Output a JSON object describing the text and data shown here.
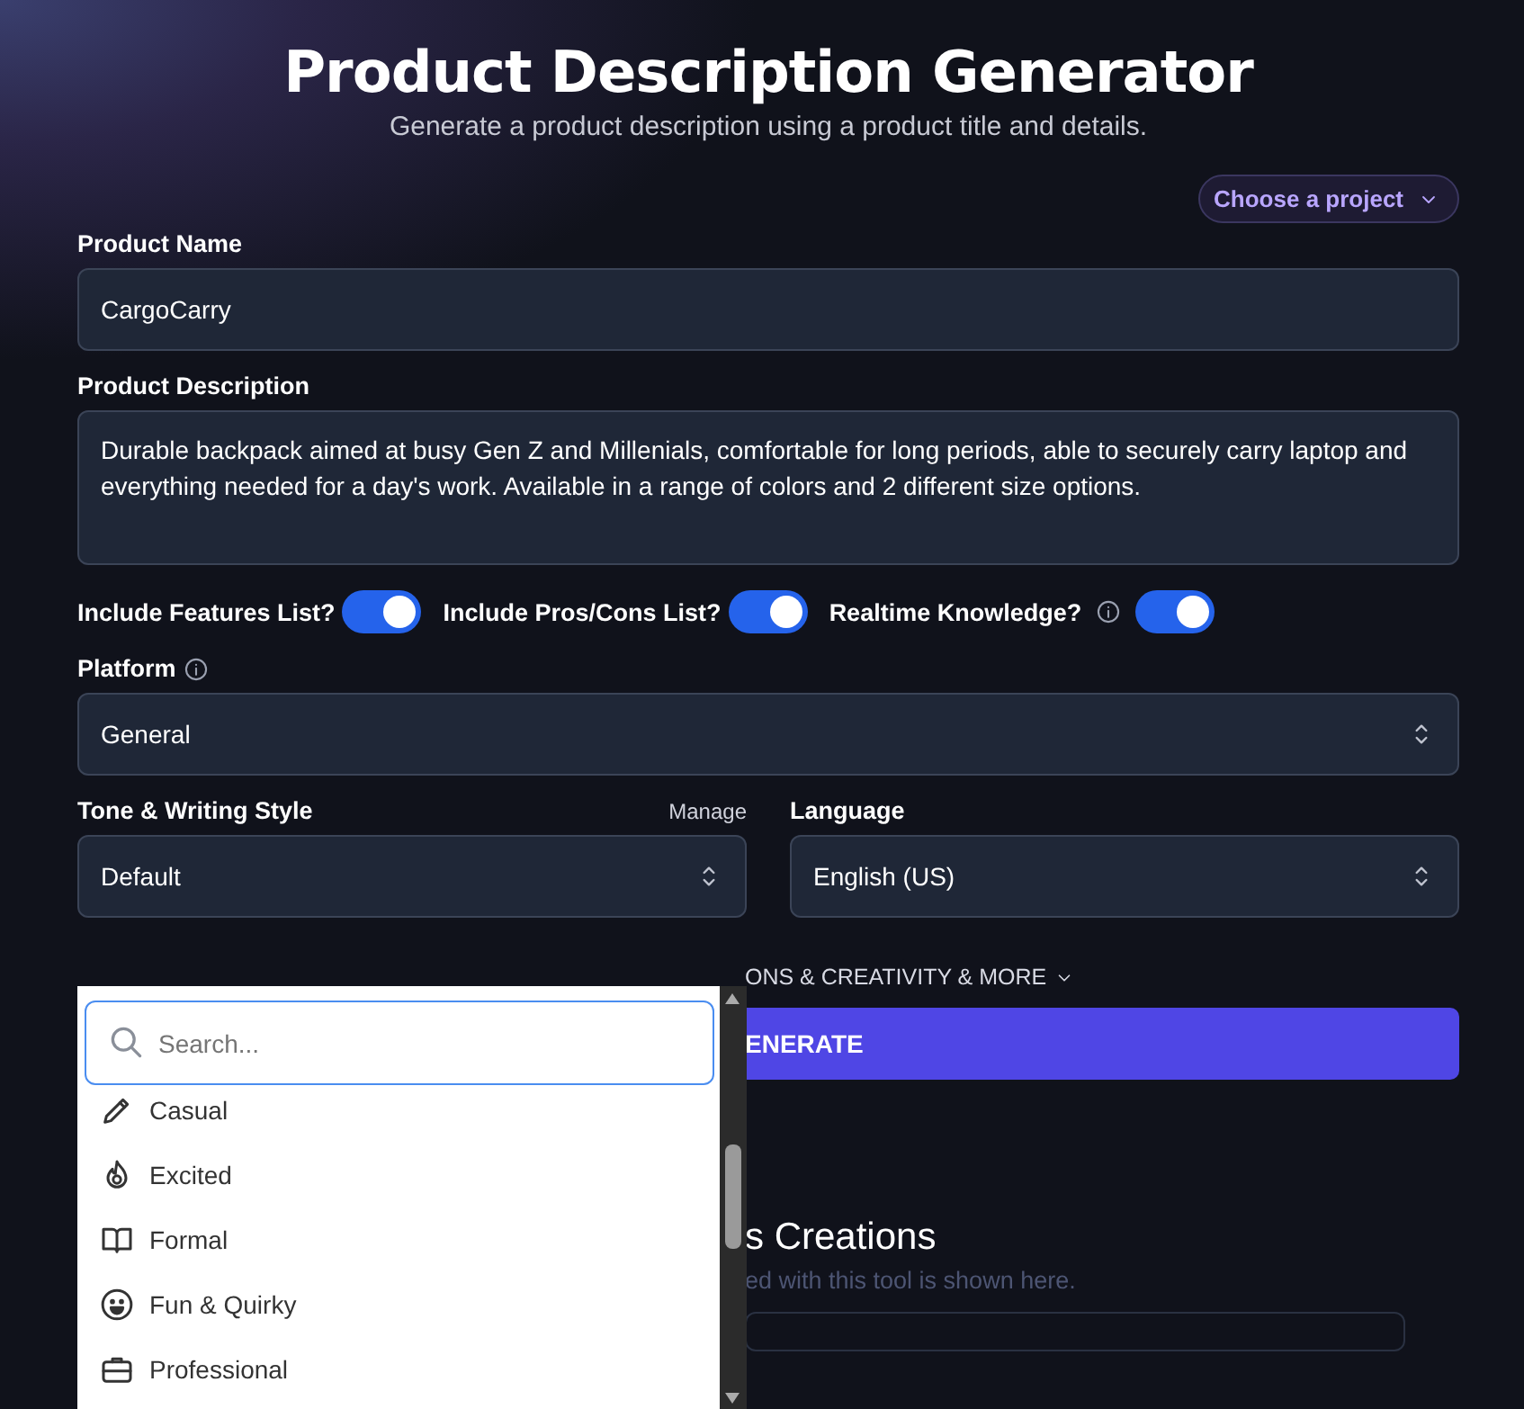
{
  "header": {
    "title": "Product Description Generator",
    "subtitle": "Generate a product description using a product title and details."
  },
  "project_button": {
    "label": "Choose a project"
  },
  "product_name": {
    "label": "Product Name",
    "value": "CargoCarry"
  },
  "product_description": {
    "label": "Product Description",
    "value": "Durable backpack aimed at busy Gen Z and Millenials, comfortable for long periods, able to securely carry laptop and everything needed for a day's work. Available in a range of colors and 2 different size options."
  },
  "toggles": [
    {
      "label": "Include Features List?",
      "info": false,
      "on": true
    },
    {
      "label": "Include Pros/Cons List?",
      "info": false,
      "on": true
    },
    {
      "label": "Realtime Knowledge?",
      "info": true,
      "on": true
    }
  ],
  "platform": {
    "label": "Platform",
    "value": "General"
  },
  "tone": {
    "label": "Tone & Writing Style",
    "manage": "Manage",
    "value": "Default"
  },
  "language": {
    "label": "Language",
    "value": "English (US)"
  },
  "options_link": "ONS & CREATIVITY & MORE",
  "generate_button": "ENERATE",
  "creations": {
    "heading": "s Creations",
    "subtitle": "ed with this tool is shown here."
  },
  "tone_menu": {
    "search_placeholder": "Search...",
    "items": [
      {
        "label": "Casual"
      },
      {
        "label": "Excited"
      },
      {
        "label": "Formal"
      },
      {
        "label": "Fun & Quirky"
      },
      {
        "label": "Professional"
      }
    ]
  }
}
